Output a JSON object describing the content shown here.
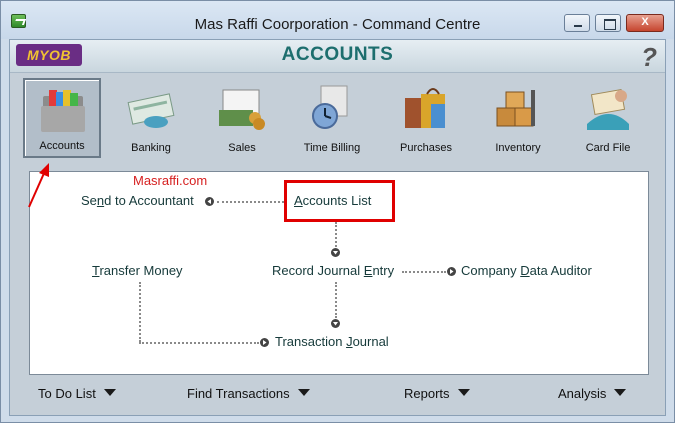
{
  "window": {
    "title": "Mas Raffi Coorporation - Command Centre",
    "controls": {
      "minimize": "",
      "maximize": "",
      "close": "X"
    }
  },
  "header": {
    "logo": "MYOB",
    "title": "ACCOUNTS",
    "help": "?"
  },
  "toolbar": {
    "items": [
      {
        "label": "Accounts",
        "icon": "accounts-folders-icon",
        "selected": true
      },
      {
        "label": "Banking",
        "icon": "banking-cheque-icon",
        "selected": false
      },
      {
        "label": "Sales",
        "icon": "sales-money-icon",
        "selected": false
      },
      {
        "label": "Time Billing",
        "icon": "time-billing-clock-icon",
        "selected": false
      },
      {
        "label": "Purchases",
        "icon": "purchases-bags-icon",
        "selected": false
      },
      {
        "label": "Inventory",
        "icon": "inventory-boxes-icon",
        "selected": false
      },
      {
        "label": "Card File",
        "icon": "card-file-icon",
        "selected": false
      }
    ]
  },
  "flow": {
    "watermark": "Masraffi.com",
    "send_to_accountant": {
      "pre": "Se",
      "u": "n",
      "post": "d to Accountant"
    },
    "accounts_list": {
      "pre": "",
      "u": "A",
      "post": "ccounts List"
    },
    "transfer_money": {
      "pre": "",
      "u": "T",
      "post": "ransfer Money"
    },
    "record_journal_entry": {
      "pre": "Record Journal ",
      "u": "E",
      "post": "ntry"
    },
    "company_data_auditor": {
      "pre": "Company ",
      "u": "D",
      "post": "ata Auditor"
    },
    "transaction_journal": {
      "pre": "Transaction ",
      "u": "J",
      "post": "ournal"
    }
  },
  "bottom": {
    "todo": "To Do List",
    "find": "Find Transactions",
    "reports": "Reports",
    "analysis": "Analysis"
  },
  "colors": {
    "highlight": "#e00000",
    "title_teal": "#1d6e6e",
    "logo_purple": "#6a2d84",
    "logo_gold": "#f1c232"
  }
}
